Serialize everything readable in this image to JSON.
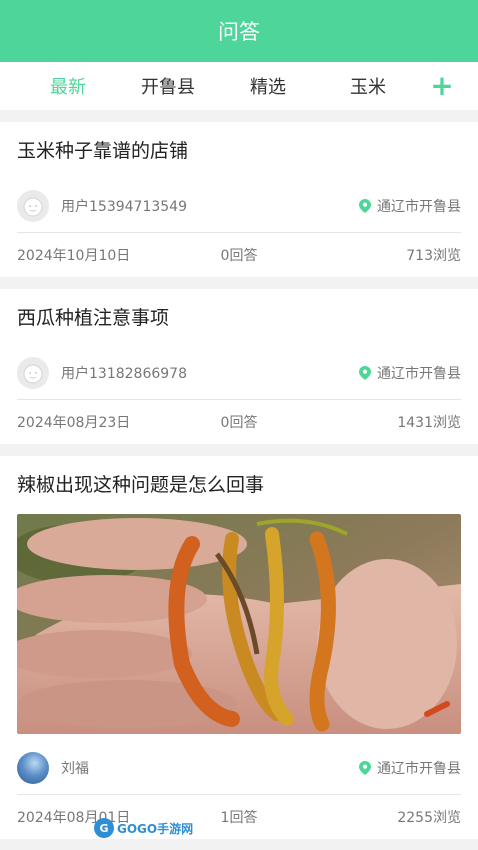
{
  "header": {
    "title": "问答"
  },
  "tabs": [
    {
      "label": "最新",
      "active": true
    },
    {
      "label": "开鲁县",
      "active": false
    },
    {
      "label": "精选",
      "active": false
    },
    {
      "label": "玉米",
      "active": false
    }
  ],
  "add_label": "+",
  "posts": [
    {
      "title": "玉米种子靠谱的店铺",
      "author": "用户15394713549",
      "location": "通辽市开鲁县",
      "date": "2024年10月10日",
      "answers": "0回答",
      "views": "713浏览"
    },
    {
      "title": "西瓜种植注意事项",
      "author": "用户13182866978",
      "location": "通辽市开鲁县",
      "date": "2024年08月23日",
      "answers": "0回答",
      "views": "1431浏览"
    },
    {
      "title": "辣椒出现这种问题是怎么回事",
      "author": "刘福",
      "location": "通辽市开鲁县",
      "date": "2024年08月01日",
      "answers": "1回答",
      "views": "2255浏览"
    }
  ],
  "watermark": {
    "logo": "G",
    "text": "GOGO手游网"
  },
  "colors": {
    "accent": "#4ed69a",
    "muted": "#777777",
    "background": "#f2f2f2"
  }
}
